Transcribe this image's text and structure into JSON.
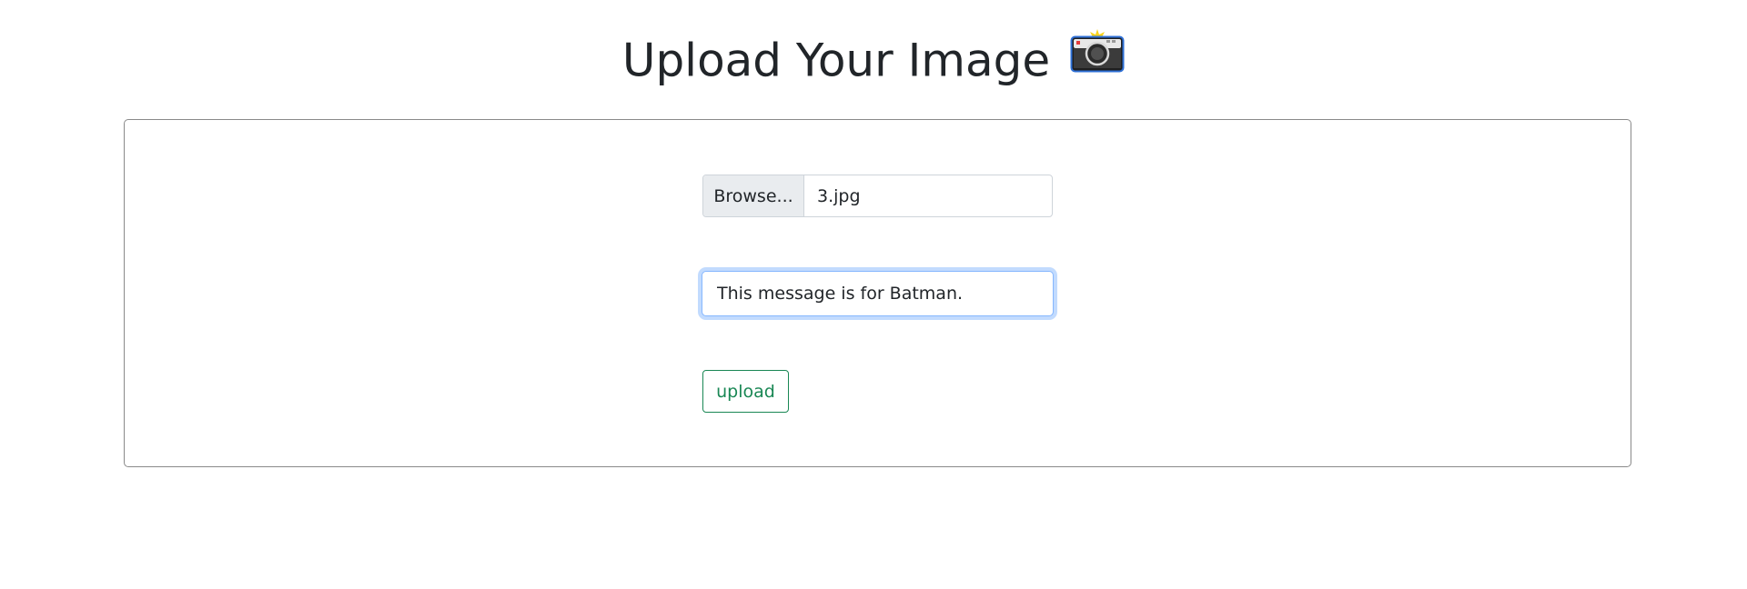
{
  "page": {
    "title": "Upload Your Image",
    "title_icon": "camera-with-flash-icon"
  },
  "form": {
    "file_input": {
      "button_label": "Browse...",
      "file_name": "3.jpg"
    },
    "message_input": {
      "value": "This message is for Batman."
    },
    "submit": {
      "label": "upload"
    }
  },
  "colors": {
    "text": "#212529",
    "card_border": "#8a8a8a",
    "focus_border": "#86b7fe",
    "success": "#198754",
    "browse_bg": "#e9ecef"
  }
}
